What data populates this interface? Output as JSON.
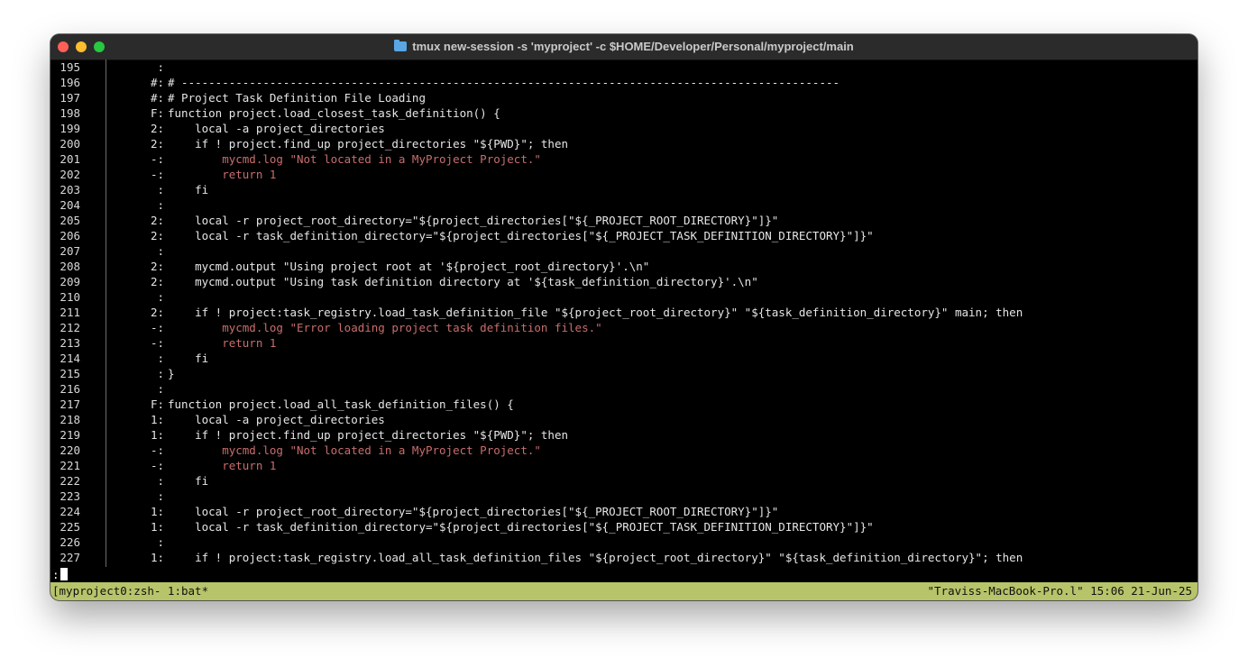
{
  "window": {
    "title": "tmux new-session -s 'myproject' -c $HOME/Developer/Personal/myproject/main",
    "title_icon": "folder-icon"
  },
  "colors": {
    "background": "#000000",
    "text": "#e6e6e6",
    "error_line": "#c86d6d",
    "statusbar_bg": "#b8c46a"
  },
  "lines": [
    {
      "num": "195",
      "marker": ":",
      "code": "",
      "style": ""
    },
    {
      "num": "196",
      "marker": "#:",
      "code": "# -------------------------------------------------------------------------------------------------",
      "style": ""
    },
    {
      "num": "197",
      "marker": "#:",
      "code": "# Project Task Definition File Loading",
      "style": ""
    },
    {
      "num": "198",
      "marker": "F:",
      "code": "function project.load_closest_task_definition() {",
      "style": ""
    },
    {
      "num": "199",
      "marker": "2:",
      "code": "    local -a project_directories",
      "style": ""
    },
    {
      "num": "200",
      "marker": "2:",
      "code": "    if ! project.find_up project_directories \"${PWD}\"; then",
      "style": ""
    },
    {
      "num": "201",
      "marker": "-:",
      "code": "        mycmd.log \"Not located in a MyProject Project.\"",
      "style": "red"
    },
    {
      "num": "202",
      "marker": "-:",
      "code": "        return 1",
      "style": "red"
    },
    {
      "num": "203",
      "marker": ":",
      "code": "    fi",
      "style": ""
    },
    {
      "num": "204",
      "marker": ":",
      "code": "",
      "style": ""
    },
    {
      "num": "205",
      "marker": "2:",
      "code": "    local -r project_root_directory=\"${project_directories[\"${_PROJECT_ROOT_DIRECTORY}\"]}\"",
      "style": ""
    },
    {
      "num": "206",
      "marker": "2:",
      "code": "    local -r task_definition_directory=\"${project_directories[\"${_PROJECT_TASK_DEFINITION_DIRECTORY}\"]}\"",
      "style": ""
    },
    {
      "num": "207",
      "marker": ":",
      "code": "",
      "style": ""
    },
    {
      "num": "208",
      "marker": "2:",
      "code": "    mycmd.output \"Using project root at '${project_root_directory}'.\\n\"",
      "style": ""
    },
    {
      "num": "209",
      "marker": "2:",
      "code": "    mycmd.output \"Using task definition directory at '${task_definition_directory}'.\\n\"",
      "style": ""
    },
    {
      "num": "210",
      "marker": ":",
      "code": "",
      "style": ""
    },
    {
      "num": "211",
      "marker": "2:",
      "code": "    if ! project:task_registry.load_task_definition_file \"${project_root_directory}\" \"${task_definition_directory}\" main; then",
      "style": ""
    },
    {
      "num": "212",
      "marker": "-:",
      "code": "        mycmd.log \"Error loading project task definition files.\"",
      "style": "red"
    },
    {
      "num": "213",
      "marker": "-:",
      "code": "        return 1",
      "style": "red"
    },
    {
      "num": "214",
      "marker": ":",
      "code": "    fi",
      "style": ""
    },
    {
      "num": "215",
      "marker": ":",
      "code": "}",
      "style": ""
    },
    {
      "num": "216",
      "marker": ":",
      "code": "",
      "style": ""
    },
    {
      "num": "217",
      "marker": "F:",
      "code": "function project.load_all_task_definition_files() {",
      "style": ""
    },
    {
      "num": "218",
      "marker": "1:",
      "code": "    local -a project_directories",
      "style": ""
    },
    {
      "num": "219",
      "marker": "1:",
      "code": "    if ! project.find_up project_directories \"${PWD}\"; then",
      "style": ""
    },
    {
      "num": "220",
      "marker": "-:",
      "code": "        mycmd.log \"Not located in a MyProject Project.\"",
      "style": "red"
    },
    {
      "num": "221",
      "marker": "-:",
      "code": "        return 1",
      "style": "red"
    },
    {
      "num": "222",
      "marker": ":",
      "code": "    fi",
      "style": ""
    },
    {
      "num": "223",
      "marker": ":",
      "code": "",
      "style": ""
    },
    {
      "num": "224",
      "marker": "1:",
      "code": "    local -r project_root_directory=\"${project_directories[\"${_PROJECT_ROOT_DIRECTORY}\"]}\"",
      "style": ""
    },
    {
      "num": "225",
      "marker": "1:",
      "code": "    local -r task_definition_directory=\"${project_directories[\"${_PROJECT_TASK_DEFINITION_DIRECTORY}\"]}\"",
      "style": ""
    },
    {
      "num": "226",
      "marker": ":",
      "code": "",
      "style": ""
    },
    {
      "num": "227",
      "marker": "1:",
      "code": "    if ! project:task_registry.load_all_task_definition_files \"${project_root_directory}\" \"${task_definition_directory}\"; then",
      "style": ""
    }
  ],
  "prompt": ":",
  "statusbar": {
    "left": "[myproject0:zsh- 1:bat*",
    "right": "\"Traviss-MacBook-Pro.l\" 15:06 21-Jun-25"
  }
}
